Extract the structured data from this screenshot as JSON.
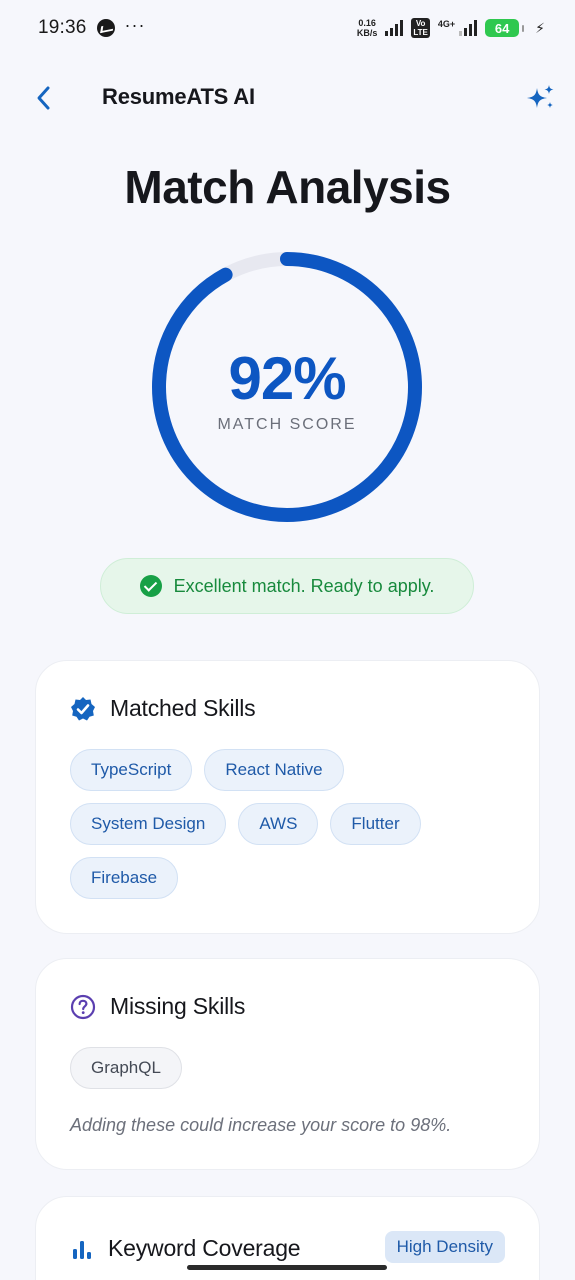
{
  "status_bar": {
    "time": "19:36",
    "net_speed_value": "0.16",
    "net_speed_unit": "KB/s",
    "volte": "Vo LTE",
    "network": "4G+",
    "battery": "64"
  },
  "app_bar": {
    "title": "ResumeATS AI"
  },
  "page": {
    "title": "Match Analysis"
  },
  "score": {
    "value": "92%",
    "percent": 92,
    "label": "MATCH SCORE"
  },
  "banner": {
    "text": "Excellent match. Ready to apply."
  },
  "matched_skills": {
    "title": "Matched Skills",
    "items": [
      "TypeScript",
      "React Native",
      "System Design",
      "AWS",
      "Flutter",
      "Firebase"
    ]
  },
  "missing_skills": {
    "title": "Missing Skills",
    "items": [
      "GraphQL"
    ],
    "hint": "Adding these could increase your score to 98%."
  },
  "keyword_coverage": {
    "title": "Keyword Coverage",
    "badge": "High Density"
  },
  "colors": {
    "accent": "#0d56c2",
    "ring_track": "#e7e8f0",
    "success": "#17a046",
    "success_bg": "#e6f6ea",
    "page_bg": "#f6f7fc"
  }
}
